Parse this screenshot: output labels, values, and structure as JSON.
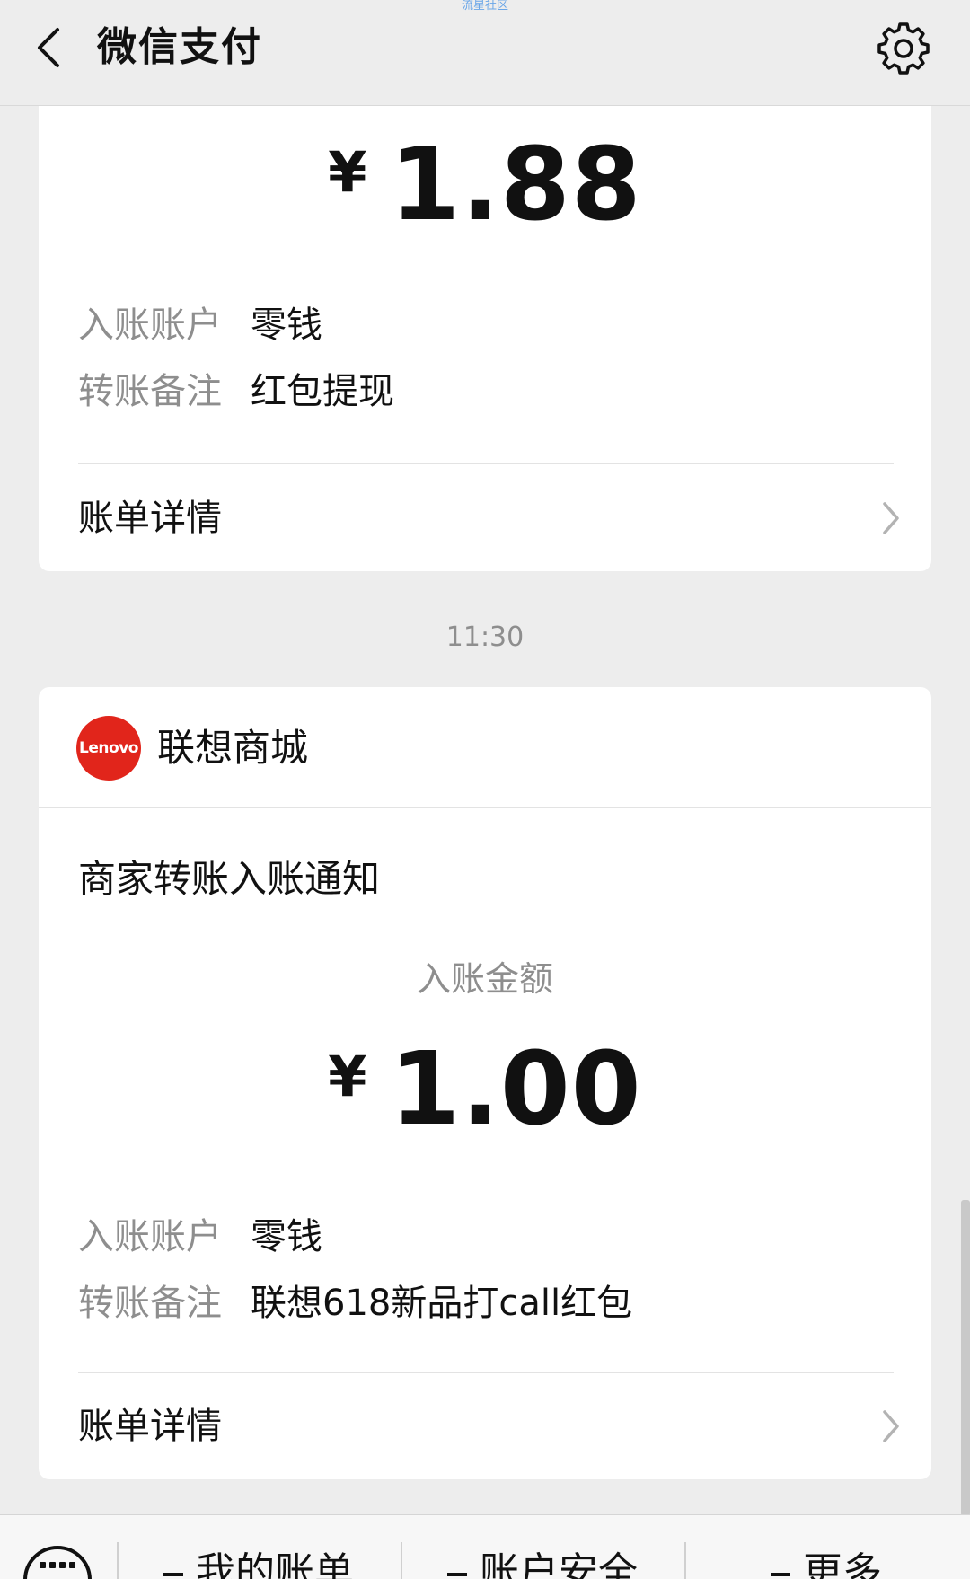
{
  "watermark": "流星社区",
  "header": {
    "title": "微信支付"
  },
  "card1": {
    "currency": "¥",
    "amount": "1.88",
    "account_label": "入账账户",
    "account_value": "零钱",
    "remark_label": "转账备注",
    "remark_value": "红包提现",
    "detail_label": "账单详情"
  },
  "timestamp": "11:30",
  "card2": {
    "merchant_name": "联想商城",
    "merchant_logo_text": "Lenovo",
    "notice_title": "商家转账入账通知",
    "amount_label": "入账金额",
    "currency": "¥",
    "amount": "1.00",
    "account_label": "入账账户",
    "account_value": "零钱",
    "remark_label": "转账备注",
    "remark_value": "联想618新品打call红包",
    "detail_label": "账单详情"
  },
  "bottom_menu": {
    "items": [
      {
        "label": "我的账单"
      },
      {
        "label": "账户安全"
      },
      {
        "label": "更多"
      }
    ]
  },
  "colors": {
    "background": "#ededed",
    "card": "#ffffff",
    "label_gray": "#8e8e8e",
    "lenovo_red": "#e1251b"
  }
}
